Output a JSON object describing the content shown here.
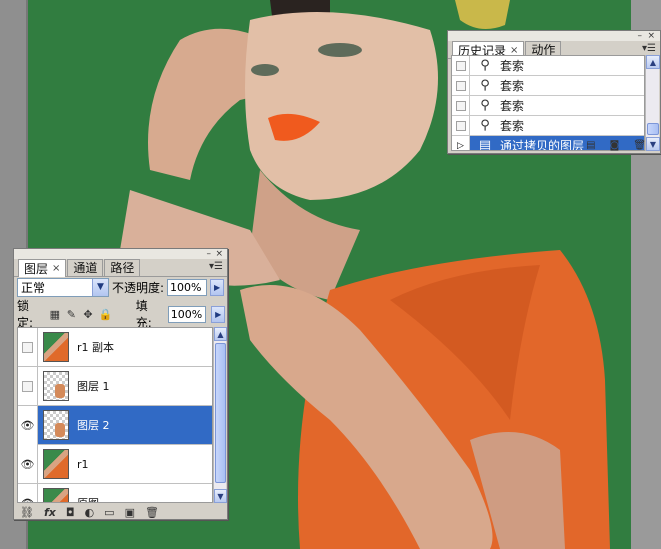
{
  "colors": {
    "canvas_bg": "#317d40",
    "selection": "#316ac5",
    "panel": "#d4d0c8"
  },
  "history_panel": {
    "tabs": [
      {
        "label": "历史记录",
        "active": true
      },
      {
        "label": "动作",
        "active": false
      }
    ],
    "tab_close": "×",
    "items": [
      {
        "label": "套索",
        "icon": "lasso-icon"
      },
      {
        "label": "套索",
        "icon": "lasso-icon"
      },
      {
        "label": "套索",
        "icon": "lasso-icon"
      },
      {
        "label": "套索",
        "icon": "lasso-icon"
      },
      {
        "label": "通过拷贝的图层",
        "icon": "layer-via-copy-icon",
        "selected": true
      }
    ]
  },
  "layers_panel": {
    "tabs": [
      {
        "label": "图层",
        "active": true
      },
      {
        "label": "通道",
        "active": false
      },
      {
        "label": "路径",
        "active": false
      }
    ],
    "tab_close": "×",
    "blend_mode": "正常",
    "opacity_label": "不透明度:",
    "opacity_value": "100%",
    "lock_label": "锁定:",
    "fill_label": "填充:",
    "fill_value": "100%",
    "layers": [
      {
        "name": "r1 副本",
        "visible": false,
        "thumb": "photo"
      },
      {
        "name": "图层 1",
        "visible": false,
        "thumb": "checker"
      },
      {
        "name": "图层 2",
        "visible": true,
        "thumb": "checker",
        "selected": true
      },
      {
        "name": "r1",
        "visible": true,
        "thumb": "photo"
      },
      {
        "name": "原图",
        "visible": true,
        "thumb": "photo"
      }
    ],
    "bottom_icons": [
      "link-icon",
      "fx-icon",
      "mask-icon",
      "adjustment-icon",
      "folder-icon",
      "new-layer-icon",
      "trash-icon"
    ],
    "fx_label": "fx"
  }
}
